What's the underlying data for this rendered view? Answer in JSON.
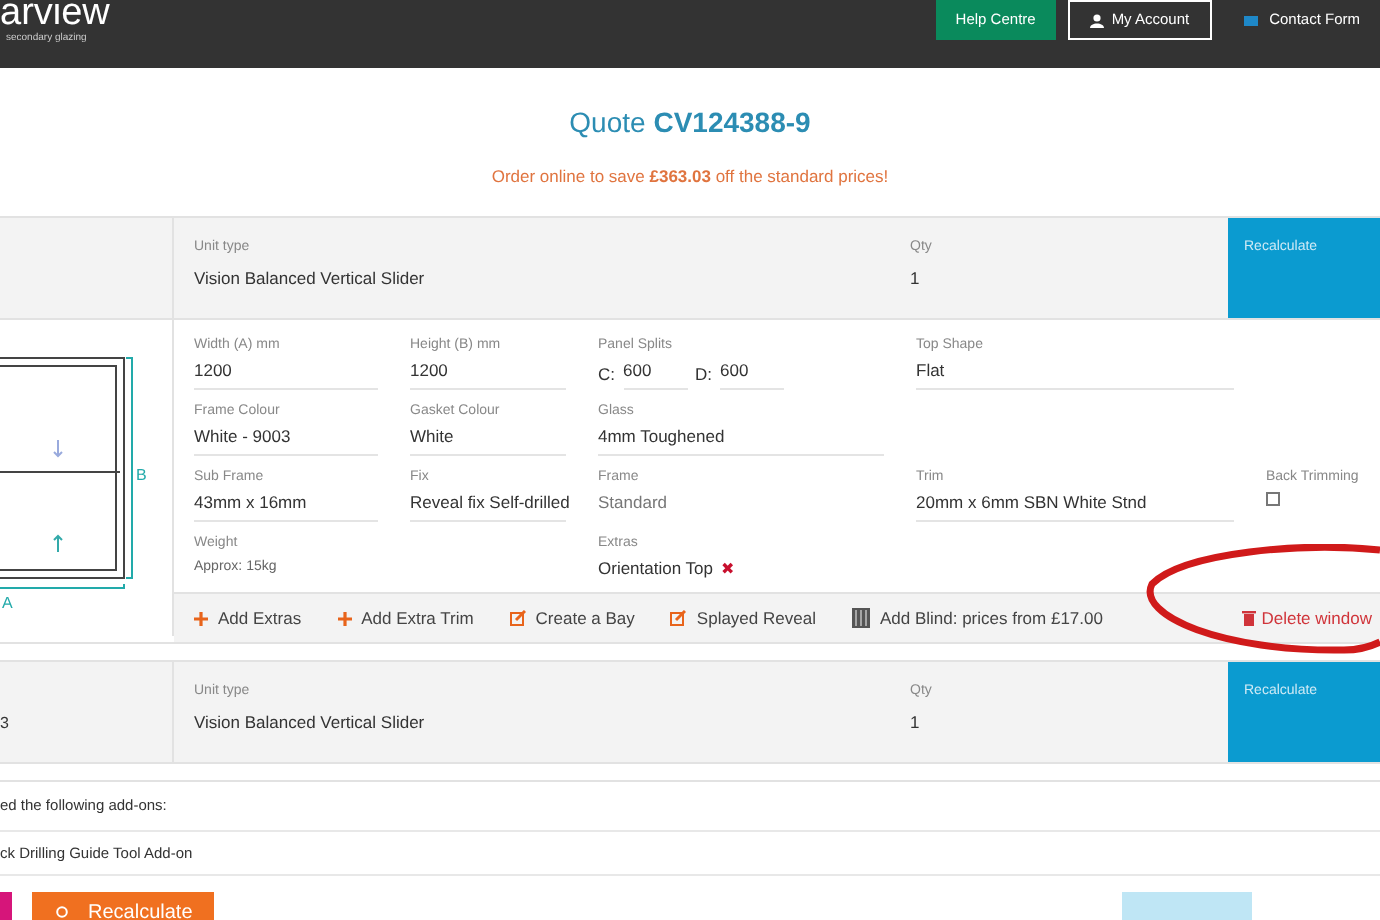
{
  "header": {
    "logo": "arview",
    "logo_sub": "secondary glazing",
    "nav": [
      {
        "kind": "primary",
        "label": "Help Centre"
      },
      {
        "kind": "account",
        "label": "My Account"
      },
      {
        "kind": "mail",
        "label": "Contact Form"
      }
    ]
  },
  "quote": {
    "title": "Quote",
    "number": "CV124388-9",
    "promo": "Order online to save **£363.03** off the standard prices!"
  },
  "windows": [
    {
      "expanded": true,
      "unit_type_label": "Unit type",
      "unit_type": "Vision Balanced Vertical Slider",
      "qty_label": "Qty",
      "qty": "1",
      "price_label": "Recalculate",
      "drawing": {
        "width_mark": "A",
        "height_mark": "B"
      },
      "fields": [
        {
          "kind": "input",
          "label": "Width (A) mm",
          "value": "1200"
        },
        {
          "kind": "input",
          "label": "Height (B) mm",
          "value": "1200"
        },
        {
          "kind": "splits",
          "label": "Panel Splits",
          "c_label": "C:",
          "c_value": "600",
          "d_label": "D:",
          "d_value": "600"
        },
        {
          "kind": "input",
          "label": "Top Shape",
          "value": "Flat"
        },
        {
          "kind": "input",
          "label": "Frame Colour",
          "value": "White - 9003"
        },
        {
          "kind": "input",
          "label": "Gasket Colour",
          "value": "White"
        },
        {
          "kind": "input",
          "label": "Glass",
          "value": "4mm Toughened"
        },
        {
          "kind": "input",
          "label": "Sub Frame",
          "value": "43mm x 16mm"
        },
        {
          "kind": "input",
          "label": "Fix",
          "value": "Reveal fix Self-drilled"
        },
        {
          "kind": "static",
          "label": "Frame",
          "value": "Standard"
        },
        {
          "kind": "input",
          "label": "Trim",
          "value": "20mm x 6mm SBN White Stnd"
        },
        {
          "kind": "checkbox",
          "label": "Back Trimming",
          "checked": false
        },
        {
          "kind": "small",
          "label": "Weight",
          "value": "Approx: 15kg"
        },
        {
          "kind": "extras",
          "label": "Extras",
          "value": "Orientation Top",
          "remove": "✖"
        }
      ],
      "actions": [
        {
          "kind": "plus",
          "label": "Add Extras"
        },
        {
          "kind": "plus",
          "label": "Add Extra Trim"
        },
        {
          "kind": "edit",
          "label": "Create a Bay"
        },
        {
          "kind": "edit",
          "label": "Splayed Reveal"
        },
        {
          "kind": "blind",
          "label": "Add Blind: prices from £17.00"
        }
      ],
      "delete": "Delete window"
    },
    {
      "name": "3",
      "expanded": false,
      "unit_type_label": "Unit type",
      "unit_type": "Vision Balanced Vertical Slider",
      "qty_label": "Qty",
      "qty": "1",
      "price_label": "Recalculate"
    }
  ],
  "addons": {
    "heading": "ed the following add-ons:",
    "items": [
      "ck Drilling Guide Tool Add-on"
    ]
  },
  "footer": {
    "recalculate": "Recalculate"
  }
}
